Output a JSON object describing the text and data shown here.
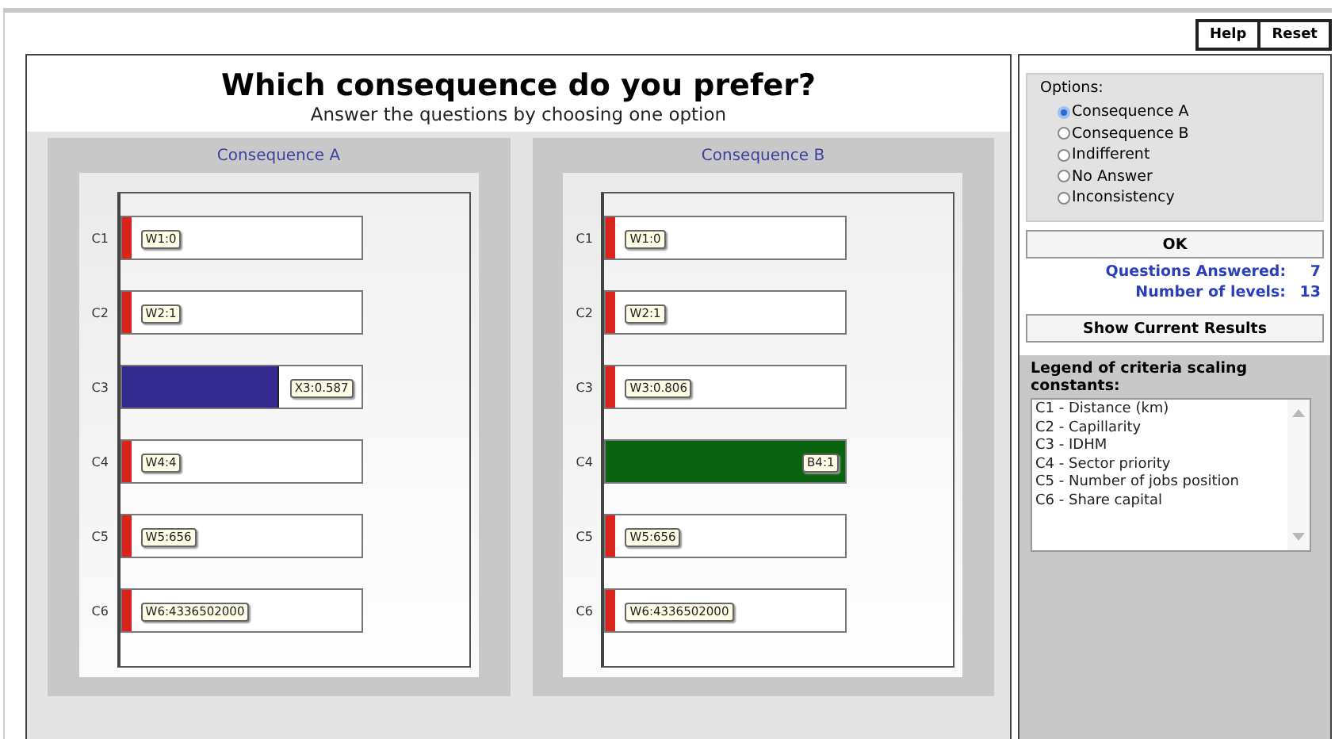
{
  "toolbar": {
    "buttons": [
      "Help",
      "Reset"
    ]
  },
  "question": {
    "title": "Which consequence do you prefer?",
    "subtitle": "Answer the questions by choosing one option"
  },
  "consequences": [
    {
      "title": "Consequence A",
      "bars": [
        {
          "axis_label": "C1",
          "kind": "worst",
          "level": 0.04,
          "value_label": "W1:0"
        },
        {
          "axis_label": "C2",
          "kind": "worst",
          "level": 0.04,
          "value_label": "W2:1"
        },
        {
          "axis_label": "C3",
          "kind": "partial",
          "level": 0.65,
          "value_label": "X3:0.587"
        },
        {
          "axis_label": "C4",
          "kind": "worst",
          "level": 0.04,
          "value_label": "W4:4"
        },
        {
          "axis_label": "C5",
          "kind": "worst",
          "level": 0.04,
          "value_label": "W5:656"
        },
        {
          "axis_label": "C6",
          "kind": "worst",
          "level": 0.04,
          "value_label": "W6:4336502000"
        }
      ]
    },
    {
      "title": "Consequence B",
      "bars": [
        {
          "axis_label": "C1",
          "kind": "worst",
          "level": 0.04,
          "value_label": "W1:0"
        },
        {
          "axis_label": "C2",
          "kind": "worst",
          "level": 0.04,
          "value_label": "W2:1"
        },
        {
          "axis_label": "C3",
          "kind": "worst",
          "level": 0.04,
          "value_label": "W3:0.806"
        },
        {
          "axis_label": "C4",
          "kind": "best",
          "level": 1,
          "value_label": "B4:1"
        },
        {
          "axis_label": "C5",
          "kind": "worst",
          "level": 0.04,
          "value_label": "W5:656"
        },
        {
          "axis_label": "C6",
          "kind": "worst",
          "level": 0.04,
          "value_label": "W6:4336502000"
        }
      ]
    }
  ],
  "options": {
    "title": "Options:",
    "items": [
      {
        "label": "Consequence A",
        "selected": true
      },
      {
        "label": "Consequence B",
        "selected": false
      },
      {
        "label": "Indifferent",
        "selected": false
      },
      {
        "label": "No Answer",
        "selected": false
      },
      {
        "label": "Inconsistency",
        "selected": false
      }
    ]
  },
  "ok_button": "OK",
  "stats": [
    {
      "label": "Questions Answered:",
      "value": "7"
    },
    {
      "label": "Number of levels:",
      "value": "13"
    }
  ],
  "results_button": "Show Current Results",
  "legend": {
    "title": "Legend of criteria scaling constants:",
    "items": [
      "C1 - Distance (km)",
      "C2 - Capillarity",
      "C3 - IDHM",
      "C4 - Sector priority",
      "C5 - Number of jobs position",
      "C6 - Share capital"
    ]
  }
}
